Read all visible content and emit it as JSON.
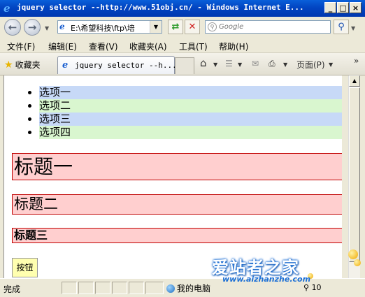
{
  "window": {
    "title": "jquery selector --http://www.51obj.cn/ - Windows Internet E...",
    "buttons": [
      "_",
      "□",
      "×"
    ]
  },
  "addressbar": {
    "address": "E:\\希望科技\\ftp\\培",
    "search_placeholder": "Google"
  },
  "menubar": {
    "items": [
      "文件(F)",
      "编辑(E)",
      "查看(V)",
      "收藏夹(A)",
      "工具(T)",
      "帮助(H)"
    ]
  },
  "tabbar": {
    "favorites_label": "收藏夹",
    "tab_label": "jquery selector --h...",
    "page_menu_label": "页面(P)",
    "chevron": "»"
  },
  "page": {
    "list_items": [
      "选项一",
      "选项二",
      "选项三",
      "选项四"
    ],
    "heading1": "标题一",
    "heading2": "标题二",
    "heading3": "标题三",
    "button_label": "按钮"
  },
  "statusbar": {
    "status": "完成",
    "zone": "我的电脑",
    "zoom": "10"
  },
  "watermark": {
    "title": "爱站者之家",
    "url": "www.aizhanzhe.com"
  },
  "colors": {
    "list_odd": "#c7d9f7",
    "list_even": "#d9f6cf",
    "heading_bg": "#ffcfcf",
    "heading_border": "#c00000",
    "button_bg": "#ffffb0"
  }
}
